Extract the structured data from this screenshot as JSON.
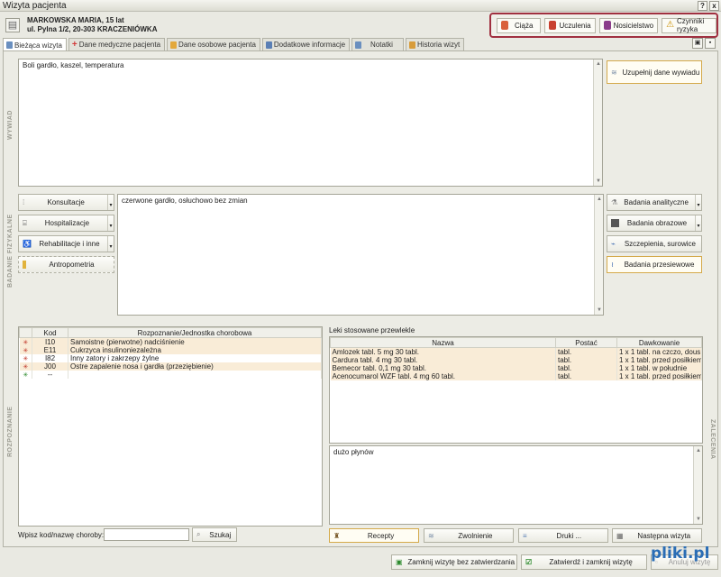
{
  "window": {
    "title": "Wizyta pacjenta",
    "help_btn": "?",
    "close_btn": "x"
  },
  "patient": {
    "name_line": "MARKOWSKA MARIA,  15 lat",
    "address_line": "ul. Pylna 1/2, 20-303 KRACZENIÓWKA"
  },
  "alerts": [
    {
      "label": "Ciąża",
      "color": "#d9603a"
    },
    {
      "label": "Uczulenia",
      "color": "#c8402f"
    },
    {
      "label": "Nosicielstwo",
      "color": "#8a3c8a"
    },
    {
      "label": "Czynniki ryzyka",
      "color": "#e3b21a"
    }
  ],
  "tabs": [
    {
      "label": "Bieżąca wizyta",
      "color": "#6a8fbf"
    },
    {
      "label": "Dane medyczne pacjenta",
      "color": "#d23a3a"
    },
    {
      "label": "Dane osobowe pacjenta",
      "color": "#e3a83b"
    },
    {
      "label": "Dodatkowe informacje",
      "color": "#5a7fb5"
    },
    {
      "label": "Notatki",
      "color": "#6a8fbf"
    },
    {
      "label": "Historia wizyt",
      "color": "#d89c3a"
    }
  ],
  "interview": {
    "section_label": "WYWIAD",
    "text": "Boli gardło, kaszel, temperatura",
    "fill_button": "Uzupełnij dane wywiadu"
  },
  "exam": {
    "section_label": "BADANIE FIZYKALNE",
    "text": "czerwone gardło, osłuchowo bez zmian",
    "left_buttons": [
      "Konsultacje",
      "Hospitalizacje",
      "Rehabilitacje i inne",
      "Antropometria"
    ],
    "right_buttons": [
      "Badania analityczne",
      "Badania obrazowe",
      "Szczepienia, surowice",
      "Badania przesiewowe"
    ]
  },
  "diagnosis": {
    "section_label": "ROZPOZNANIE",
    "columns": [
      "Kod",
      "Rozpoznanie/Jednostka chorobowa"
    ],
    "rows": [
      {
        "code": "I10",
        "name": "Samoistne (pierwotne) nadciśnienie"
      },
      {
        "code": "E11",
        "name": "Cukrzyca insulinoniezależna"
      },
      {
        "code": "I82",
        "name": "Inny zatory i zakrzepy żylne"
      },
      {
        "code": "J00",
        "name": "Ostre zapalenie nosa i gardła (przeziębienie)"
      },
      {
        "code": "--",
        "name": ""
      }
    ],
    "search_label": "Wpisz kod/nazwę choroby:",
    "search_value": "",
    "search_button": "Szukaj"
  },
  "meds": {
    "title": "Leki stosowane przewlekle",
    "columns": [
      "Nazwa",
      "Postać",
      "Dawkowanie"
    ],
    "rows": [
      {
        "name": "Amlozek tabl. 5 mg 30 tabl.",
        "form": "tabl.",
        "dose": "1 x 1 tabl. na czczo, dous"
      },
      {
        "name": "Cardura tabl. 4 mg 30 tabl.",
        "form": "tabl.",
        "dose": "1 x 1 tabl. przed posiłkiem"
      },
      {
        "name": "Bemecor tabl. 0,1 mg 30 tabl.",
        "form": "tabl.",
        "dose": "1 x 1 tabl. w południe"
      },
      {
        "name": "Acenocumarol WZF tabl. 4 mg 60 tabl.",
        "form": "tabl.",
        "dose": "1 x 1 tabl. przed posiłkiem"
      }
    ]
  },
  "recommendations": {
    "section_label": "ZALECENIA",
    "text": "dużo płynów",
    "buttons": [
      "Recepty",
      "Zwolnienie",
      "Druki ...",
      "Następna wizyta"
    ]
  },
  "footer": {
    "close_no_confirm": "Zamknij wizytę bez zatwierdzania",
    "confirm_close": "Zatwierdź i zamknij wizytę",
    "cancel": "Anuluj wizytę"
  },
  "watermark": "pliki.pl"
}
